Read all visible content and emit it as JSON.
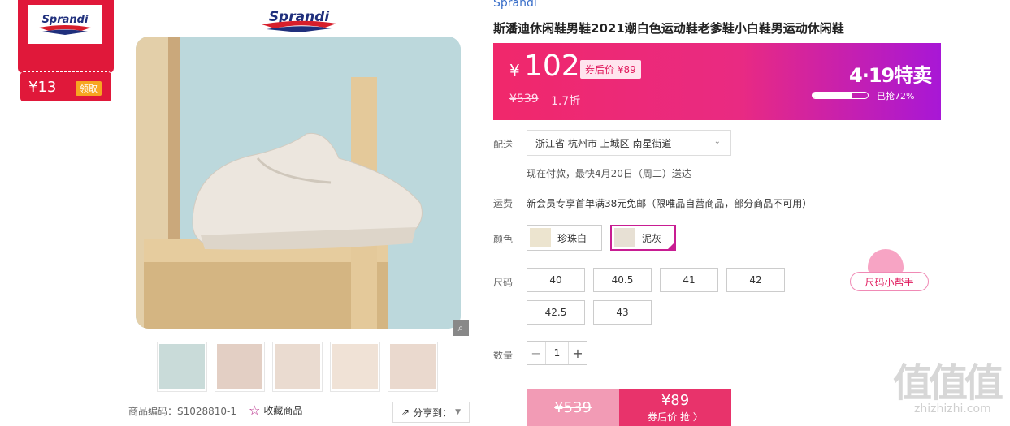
{
  "coupon": {
    "brand": "Sprandi",
    "price": "¥13",
    "claim": "领取"
  },
  "brand_logo": "Sprandi",
  "product": {
    "brand_link": "Sprandi",
    "title": "斯潘迪休闲鞋男鞋2021潮白色运动鞋老爹鞋小白鞋男运动休闲鞋",
    "code": "商品编码：S1028810-1",
    "favorite": "收藏商品",
    "share": "分享到："
  },
  "price": {
    "yen": "¥",
    "current": "102",
    "after_coupon": "券后价 ¥89",
    "original": "¥539",
    "discount": "1.7折",
    "promo": "4·19特卖",
    "sold_label": "已抢72%",
    "sold_fraction": 0.72
  },
  "delivery": {
    "label": "配送",
    "address": "浙江省 杭州市 上城区 南星街道",
    "eta": "现在付款，最快4月20日（周二）送达"
  },
  "shipping": {
    "label": "运费",
    "text": "新会员专享首单满38元免邮（限唯品自营商品，部分商品不可用）"
  },
  "colors": {
    "label": "颜色",
    "options": [
      {
        "name": "珍珠白",
        "selected": false
      },
      {
        "name": "泥灰",
        "selected": true
      }
    ]
  },
  "sizes": {
    "label": "尺码",
    "options": [
      "40",
      "40.5",
      "41",
      "42",
      "42.5",
      "43"
    ],
    "helper": "尺码小帮手"
  },
  "quantity": {
    "label": "数量",
    "value": "1",
    "minus": "−",
    "plus": "+"
  },
  "buy": {
    "original": "¥539",
    "price": "¥89",
    "action": "券后价 抢 〉"
  },
  "watermark": {
    "big": "值值值",
    "small": "zhizhizhi.com"
  },
  "colors_theme": {
    "accent": "#e8336b",
    "banner_end": "#a817d6",
    "link": "#3a6fc9"
  }
}
